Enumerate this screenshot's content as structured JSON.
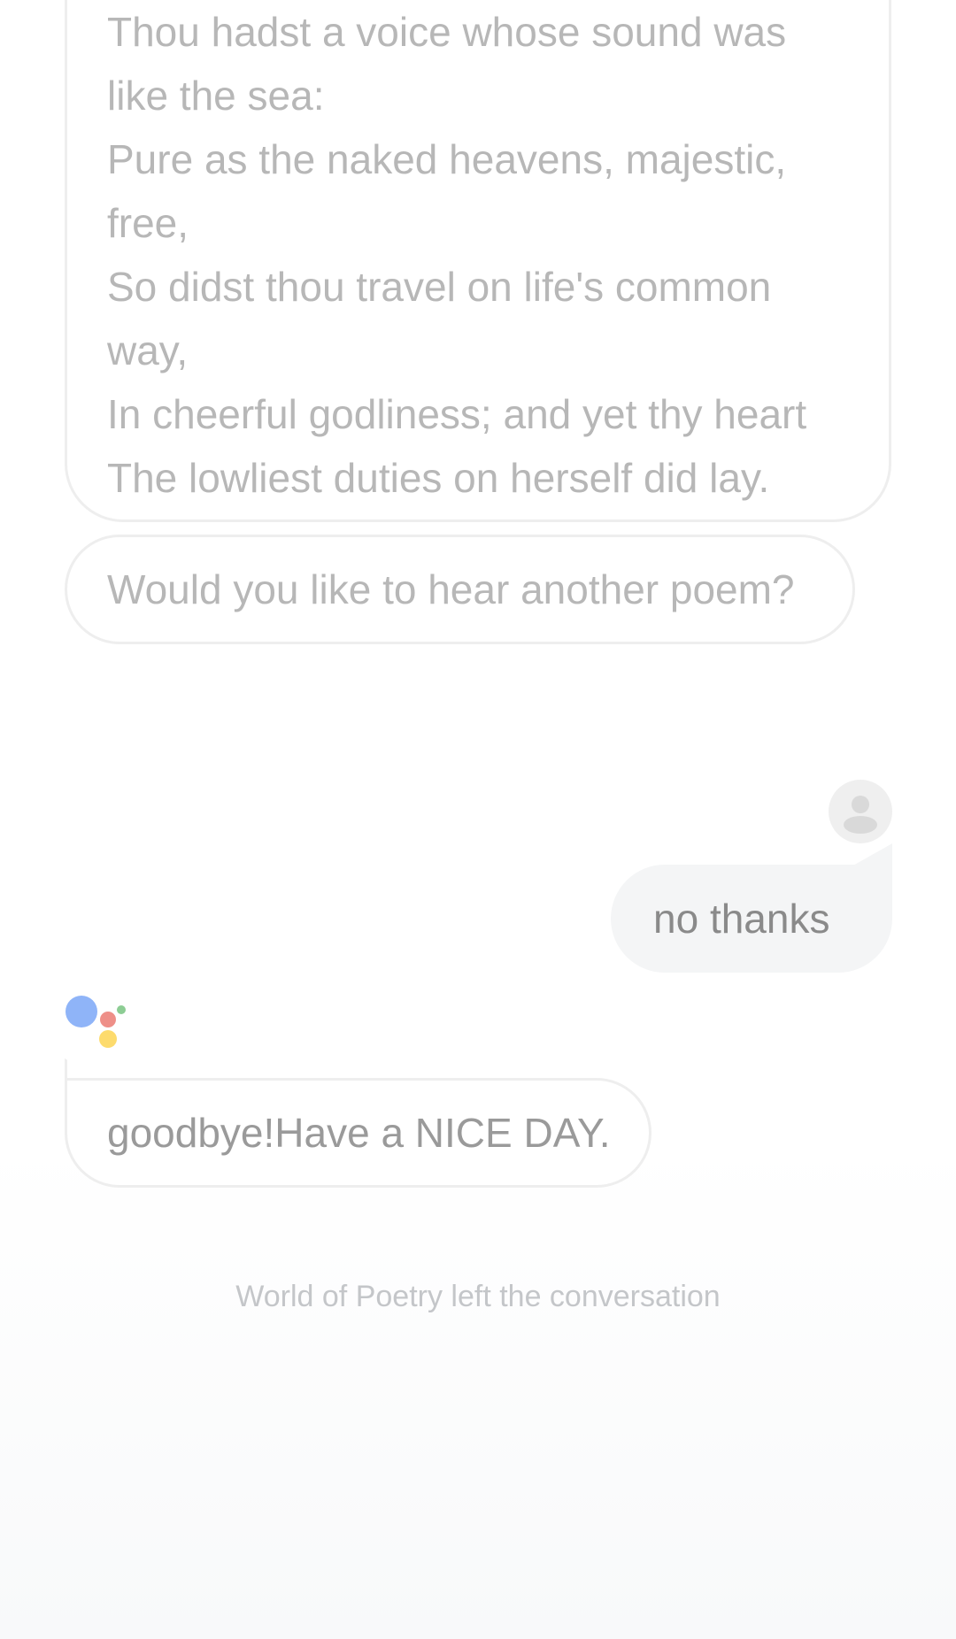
{
  "conversation": {
    "poem_lines": [
      "Thou hadst a voice whose sound was",
      "like the sea:",
      "Pure as the naked heavens, majestic,",
      "free,",
      "So didst thou travel on life's common",
      "way,",
      "In cheerful godliness; and yet thy heart",
      "The lowliest duties on herself did lay."
    ],
    "assistant_question": "Would you like to hear another poem?",
    "user_reply": "no thanks",
    "assistant_goodbye": "goodbye!Have a NICE DAY.",
    "system_notice": "World of Poetry left the conversation"
  },
  "colors": {
    "assistant_logo_blue": "#8fb4f8",
    "assistant_logo_red": "#ee8f88",
    "assistant_logo_yellow": "#fddb6d",
    "assistant_logo_green": "#8dcd94"
  },
  "icons": {
    "user_avatar": "person-icon",
    "assistant_logo": "google-assistant-logo-icon"
  }
}
